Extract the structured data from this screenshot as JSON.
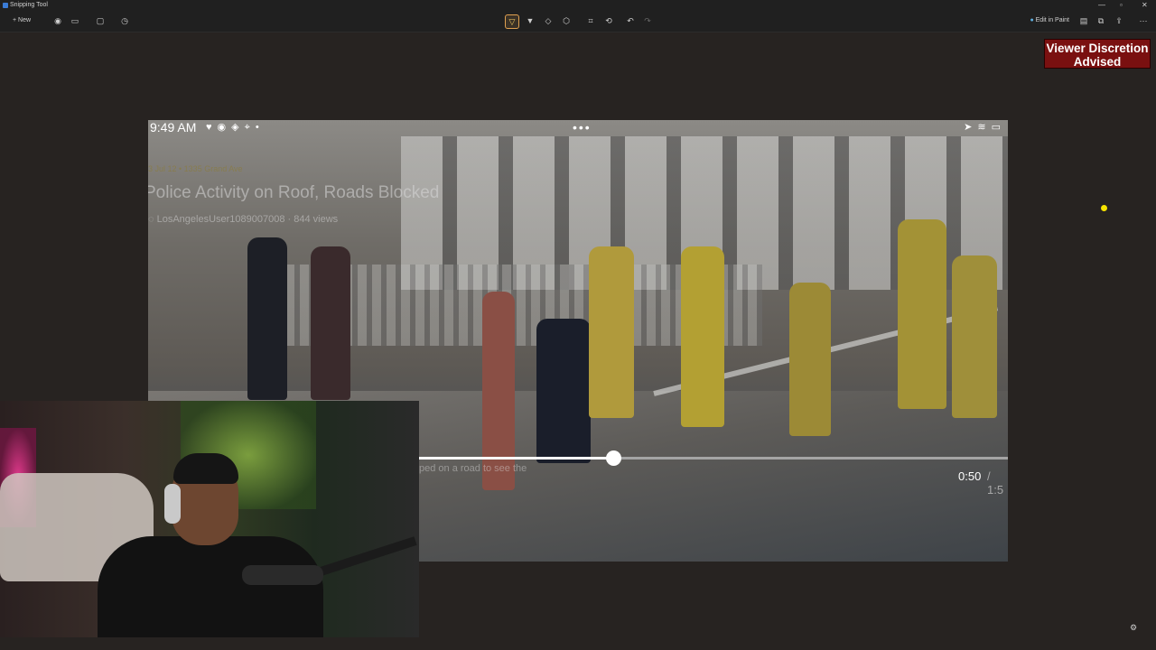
{
  "window": {
    "title": "Snipping Tool"
  },
  "toolbar": {
    "new_label": "New",
    "edit_in_paint_label": "Edit in Paint"
  },
  "badge": {
    "line1": "Viewer Discretion",
    "line2": "Advised"
  },
  "video": {
    "status_time": "9:49 AM",
    "meta_date": "3 Jul 12 • 1335 Grand Ave",
    "title": "Police Activity on Roof, Roads Blocked",
    "user_line": "LosAngelesUser1089007008 · 844 views",
    "caption": "ped on a road to see the",
    "time_current": "0:50",
    "time_total": "/ 1:5",
    "progress": 0.33
  },
  "colors": {
    "badge_bg": "#7a1010",
    "accent": "#e0a050"
  }
}
